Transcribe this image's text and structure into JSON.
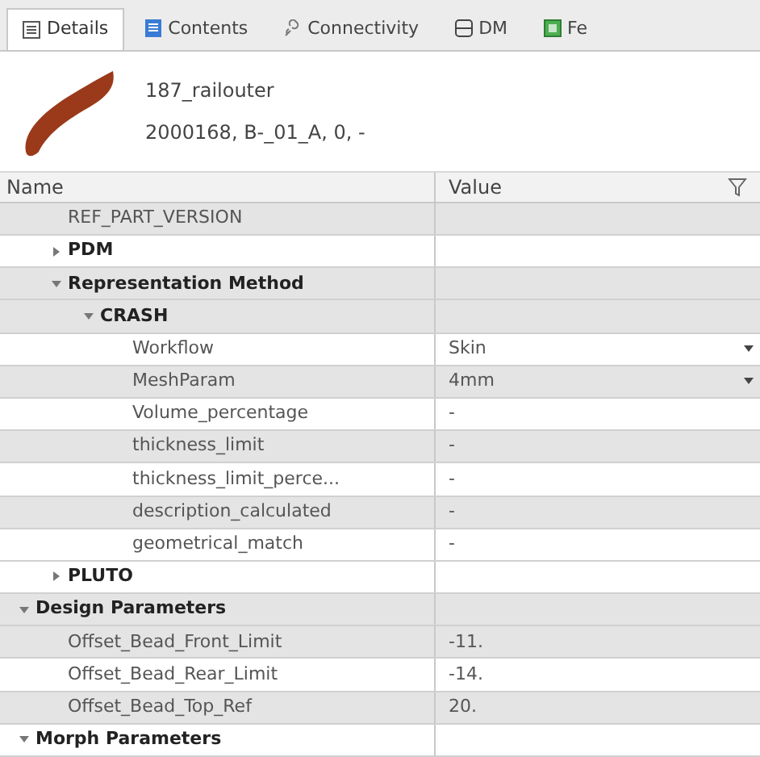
{
  "tabs": [
    {
      "label": "Details",
      "kind": "details",
      "selected": true
    },
    {
      "label": "Contents",
      "kind": "contents",
      "selected": false
    },
    {
      "label": "Connectivity",
      "kind": "link",
      "selected": false
    },
    {
      "label": "DM",
      "kind": "dm",
      "selected": false
    },
    {
      "label": "Fe",
      "kind": "feature",
      "selected": false
    }
  ],
  "part": {
    "name": "187_railouter",
    "info": "2000168, B-_01_A, 0, -"
  },
  "table": {
    "columns": [
      "Name",
      "Value"
    ],
    "tree": [
      {
        "children": [
          {
            "kind": "property",
            "label": "REF_PART_VERSION"
          },
          {
            "kind": "group",
            "label": "PDM",
            "expanded": false
          },
          {
            "kind": "group",
            "label": "Representation Method",
            "expanded": true,
            "children": [
              {
                "kind": "group",
                "label": "CRASH",
                "expanded": true,
                "children": [
                  {
                    "kind": "property",
                    "label": "Workflow",
                    "value": "Skin",
                    "dropdown": true
                  },
                  {
                    "kind": "property",
                    "label": "MeshParam",
                    "value": "4mm",
                    "dropdown": true
                  },
                  {
                    "kind": "property",
                    "label": "Volume_percentage",
                    "value": "-"
                  },
                  {
                    "kind": "property",
                    "label": "thickness_limit",
                    "value": "-"
                  },
                  {
                    "kind": "property",
                    "label": "thickness_limit_perce...",
                    "value": "-"
                  },
                  {
                    "kind": "property",
                    "label": "description_calculated",
                    "value": "-"
                  },
                  {
                    "kind": "property",
                    "label": "geometrical_match",
                    "value": "-"
                  }
                ]
              }
            ]
          },
          {
            "kind": "group",
            "label": "PLUTO",
            "expanded": false
          }
        ]
      },
      {
        "kind": "group",
        "label": "Design Parameters",
        "expanded": true,
        "children": [
          {
            "kind": "property",
            "label": "Offset_Bead_Front_Limit",
            "value": "-11."
          },
          {
            "kind": "property",
            "label": "Offset_Bead_Rear_Limit",
            "value": "-14."
          },
          {
            "kind": "property",
            "label": "Offset_Bead_Top_Ref",
            "value": "20."
          }
        ]
      },
      {
        "kind": "group",
        "label": "Morph Parameters",
        "expanded": true
      }
    ]
  }
}
